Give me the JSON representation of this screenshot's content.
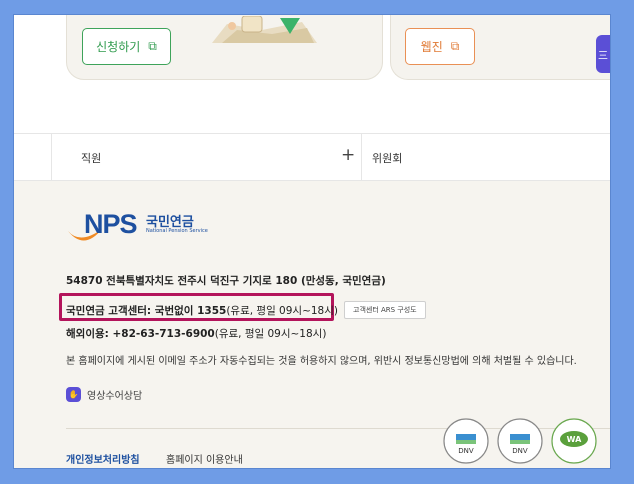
{
  "top_cards": {
    "apply_label": "신청하기",
    "webzine_label": "웹진",
    "side_tab_label": "三"
  },
  "accordion": {
    "left_label": "직원",
    "toggle_symbol": "+",
    "right_label": "위원회"
  },
  "footer": {
    "logo": {
      "brand": "NPS",
      "name_kr": "국민연금",
      "name_en": "National Pension Service"
    },
    "address": "54870 전북특별자치도 전주시 덕진구 기지로 180 (만성동, 국민연금)",
    "call_center": {
      "label_bold": "국민연금 고객센터: 국번없이 1355",
      "label_rest": "(유료, 평일 09시~18시)",
      "ars_button": "고객센터 ARS 구성도"
    },
    "international": {
      "label_bold": "해외이용: +82-63-713-6900",
      "label_rest": "(유료, 평일 09시~18시)"
    },
    "notice": "본 홈페이지에 게시된 이메일 주소가 자동수집되는 것을 허용하지 않으며, 위반시 정보통신망법에 의해 처벌될 수 있습니다.",
    "sign_language": "영상수어상담",
    "links": {
      "privacy": "개인정보처리방침",
      "usage": "홈페이지 이용안내"
    },
    "certs": [
      "DNV",
      "DNV",
      "WA"
    ]
  },
  "colors": {
    "green": "#2e9a4c",
    "orange": "#e07a35",
    "brand_blue": "#1e50a0",
    "highlight": "#b3145b",
    "purple": "#5b4fd6"
  }
}
